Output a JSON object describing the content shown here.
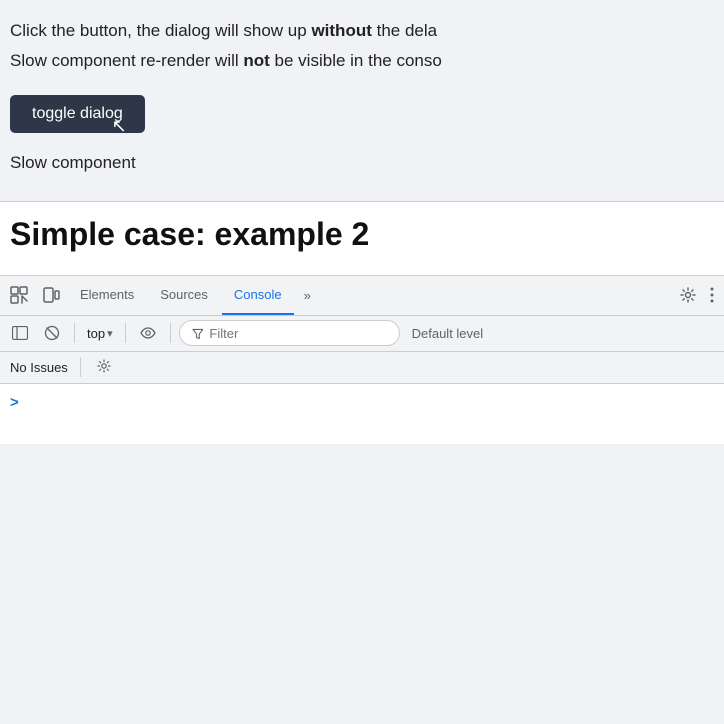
{
  "content": {
    "line1_prefix": "Click the button, the dialog will show up ",
    "line1_bold": "without",
    "line1_suffix": " the dela",
    "line2_prefix": "Slow component re-render will ",
    "line2_bold": "not",
    "line2_suffix": " be visible in the conso",
    "toggle_btn_label": "toggle dialog",
    "slow_component_label": "Slow component"
  },
  "example2": {
    "heading": "Simple case: example 2"
  },
  "devtools": {
    "tabs": {
      "elements_label": "Elements",
      "sources_label": "Sources",
      "console_label": "Console",
      "chevron": "»"
    },
    "toolbar": {
      "top_label": "top",
      "filter_placeholder": "Filter",
      "default_level_label": "Default level"
    },
    "issues": {
      "no_issues_label": "No Issues"
    },
    "console": {
      "prompt_chevron": ">"
    }
  },
  "icons": {
    "inspect_element": "⊡",
    "device_toolbar": "⊡",
    "clear_console": "⊘",
    "eye": "◉",
    "filter": "⊿",
    "settings": "⚙",
    "more_options": "⋮",
    "sidebar": "⊞",
    "chevron_down": "▾",
    "gear": "⚙"
  }
}
